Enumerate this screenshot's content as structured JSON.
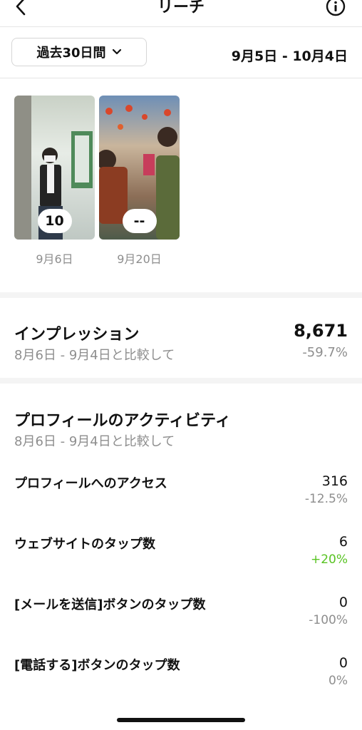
{
  "header": {
    "title": "リーチ"
  },
  "filter": {
    "period_label": "過去30日間",
    "date_range": "9月5日 - 10月4日"
  },
  "posts": [
    {
      "count": "10",
      "date": "9月6日"
    },
    {
      "count": "--",
      "date": "9月20日"
    }
  ],
  "impressions": {
    "title": "インプレッション",
    "comparison": "8月6日 - 9月4日と比較して",
    "value": "8,671",
    "change": "-59.7%"
  },
  "profile_activity": {
    "title": "プロフィールのアクティビティ",
    "comparison": "8月6日 - 9月4日と比較して",
    "metrics": [
      {
        "label": "プロフィールへのアクセス",
        "value": "316",
        "change": "-12.5%"
      },
      {
        "label": "ウェブサイトのタップ数",
        "value": "6",
        "change": "+20%"
      },
      {
        "label": "[メールを送信]ボタンのタップ数",
        "value": "0",
        "change": "-100%"
      },
      {
        "label": "[電話する]ボタンのタップ数",
        "value": "0",
        "change": "0%"
      }
    ]
  },
  "colors": {
    "positive": "#58c322",
    "muted": "#8e8e8e"
  }
}
